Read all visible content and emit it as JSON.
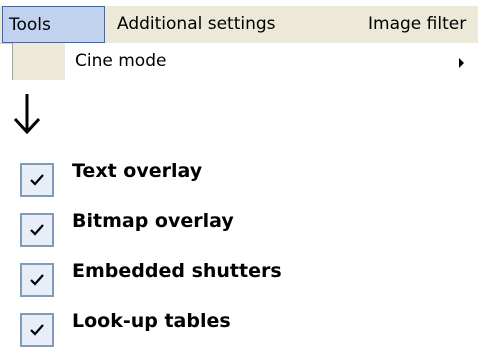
{
  "menubar": {
    "tabs": [
      {
        "label": "Tools",
        "active": true
      },
      {
        "label": "Additional settings",
        "active": false
      },
      {
        "label": "Image filter",
        "active": false
      }
    ]
  },
  "dropdown": {
    "items": [
      {
        "label": "Cine mode",
        "has_submenu": true,
        "submenu_icon": "chevron-right-icon"
      }
    ]
  },
  "arrow": {
    "icon": "arrow-down-icon"
  },
  "options": [
    {
      "label": "Text overlay",
      "checked": true
    },
    {
      "label": "Bitmap overlay",
      "checked": true
    },
    {
      "label": "Embedded shutters",
      "checked": true
    },
    {
      "label": "Look-up tables",
      "checked": true
    }
  ],
  "colors": {
    "menubar_bg": "#ece9d8",
    "active_tab_bg": "#c1d2ee",
    "active_tab_border": "#316ac5",
    "checkbox_bg": "#e8eef8",
    "checkbox_border": "#7f9db9"
  }
}
